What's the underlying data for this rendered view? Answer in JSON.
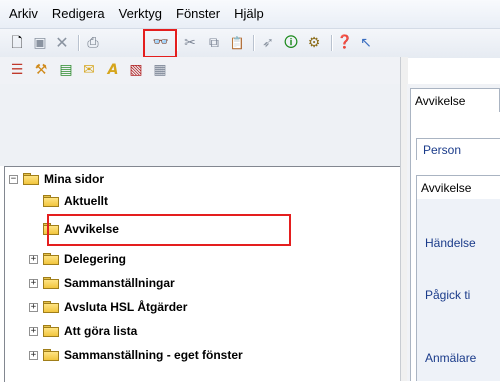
{
  "menu": [
    "Arkiv",
    "Redigera",
    "Verktyg",
    "Fönster",
    "Hjälp"
  ],
  "toolbar": {
    "icons": [
      "new-document-icon",
      "save-icon",
      "delete-icon",
      "print-icon",
      "search-binoculars-icon",
      "cut-icon",
      "copy-icon",
      "paste-icon",
      "pin-icon",
      "info-icon",
      "tool-icon",
      "help-circle-icon",
      "pointer-help-icon"
    ],
    "glyphs": {
      "new": "🗋",
      "save": "▣",
      "delete": "✕",
      "print": "⎙",
      "search": "👓",
      "cut": "✂",
      "copy": "⧉",
      "paste": "📋",
      "pin": "➶",
      "info": "🛈",
      "tool": "⚙",
      "help": "❓",
      "pointer_help": "↖"
    }
  },
  "toolbar2": {
    "icons": [
      "list-icon",
      "tools-icon",
      "monitor-icon",
      "mail-icon",
      "font-icon",
      "report-icon",
      "calendar-icon"
    ],
    "glyphs": {
      "list": "☰",
      "tools": "⚒",
      "monitor": "▤",
      "mail": "✉",
      "font": "A",
      "report": "▧",
      "calendar": "▦"
    }
  },
  "tree": {
    "root": "Mina sidor",
    "items": [
      {
        "label": "Aktuellt"
      },
      {
        "label": "Avvikelse"
      },
      {
        "label": "Delegering"
      },
      {
        "label": "Sammanställningar"
      },
      {
        "label": "Avsluta HSL Åtgärder"
      },
      {
        "label": "Att göra lista"
      },
      {
        "label": "Sammanställning - eget fönster"
      }
    ]
  },
  "right_panel": {
    "tab_title": "Avvikelse",
    "subtab": "Person",
    "inner_tab": "Avvikelse",
    "fields": [
      "Händelse",
      "Pågick ti",
      "Anmälare"
    ]
  },
  "colors": {
    "highlight": "#e41e1e",
    "folder": "#f1c53e",
    "label_blue": "#1a3b8a"
  }
}
